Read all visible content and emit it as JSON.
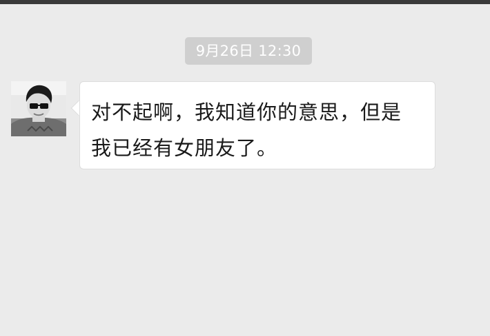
{
  "timestamp": "9月26日 12:30",
  "message": {
    "line1": "对不起啊，我知道你的意思，但是",
    "line2": "我已经有女朋友了。",
    "bubble_color": "#ffffff"
  },
  "avatar": {
    "icon": "profile-photo-with-sunglasses"
  },
  "colors": {
    "background": "#ebebeb",
    "timestamp_bg": "#cfcfcf",
    "top_bar": "#3a3a3a"
  }
}
